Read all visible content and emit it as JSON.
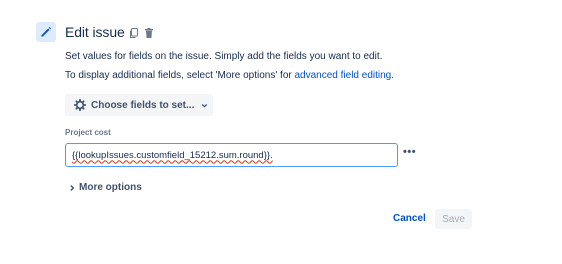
{
  "header": {
    "title": "Edit issue",
    "action_icon": "pencil-icon",
    "copy_icon": "copy-icon",
    "delete_icon": "trash-icon"
  },
  "description": {
    "line1": "Set values for fields on the issue. Simply add the fields you want to edit.",
    "line2_prefix": "To display additional fields, select 'More options' for ",
    "line2_link": "advanced field editing",
    "line2_suffix": "."
  },
  "choose_fields": {
    "label": "Choose fields to set...",
    "icon": "gear-icon",
    "chevron": "chevron-down-icon"
  },
  "project_cost": {
    "label": "Project cost",
    "value": "{{lookupIssues.customfield_15212.sum.round}}.",
    "options_icon": "ellipsis-icon",
    "options_text": "•••"
  },
  "more_options": {
    "label": "More options",
    "icon": "chevron-right-icon"
  },
  "footer": {
    "cancel_label": "Cancel",
    "save_label": "Save"
  },
  "colors": {
    "accent": "#0052cc",
    "focus_border": "#4c9aff",
    "badge_bg": "#deebff",
    "text": "#172b4d",
    "muted": "#6b778c",
    "button_bg": "#f4f5f7",
    "disabled_text": "#a5adba",
    "spellcheck": "#de350b"
  }
}
